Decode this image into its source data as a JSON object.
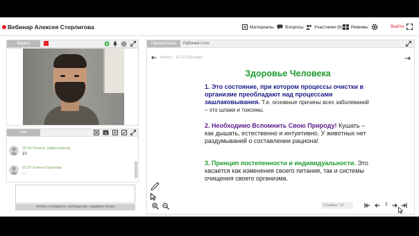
{
  "header": {
    "title": "Вебинар Алексея Стерлигова",
    "nav": {
      "materials": "Материалы",
      "questions": "Вопросы",
      "participants": "Участники (6)",
      "modes": "Режимы"
    },
    "exit": "Выйти"
  },
  "video": {
    "tab": "Видео"
  },
  "chat": {
    "tab": "Чат",
    "messages": [
      {
        "time": "20:04",
        "author": "Ренель Хайруллинов",
        "text": "10"
      },
      {
        "time": "20:07",
        "author": "Елена Горелова",
        "text": "..."
      }
    ],
    "send_label": "Чтобы отправить сообщение, нажмите Enter"
  },
  "presentation": {
    "tab": "Презентация",
    "desktop_tab": "Рабочий стол",
    "file_name": "Sekret... 15.12.2016.pptx",
    "slide": {
      "title": "Здоровье Человека",
      "items": [
        {
          "number": "1.",
          "bold": "Это состояние, при котором процессы очистки в организме преобладают над процессами зашлаковывания.",
          "rest": "Т.е. основные причины всех заболеваний – это шлаки и токсины."
        },
        {
          "number": "2.",
          "bold": "Необходимо Вспомнить Свою Природу!",
          "rest": "Кушать – как дышать, естественно и интуитивно. У животных нет раздумываний о составлении рациона!"
        },
        {
          "number": "3.",
          "bold": "Принцип постепенности и индивидуальности.",
          "rest": "Это касается как изменения своего питания, так и системы очищения своего организма."
        }
      ]
    },
    "pager": {
      "label": "Слайды",
      "total": "12",
      "current": "3"
    }
  },
  "colors": {
    "accent_red": "#e8202a",
    "slide_title": "#1d9b2d",
    "item1_bold": "#1c1c88",
    "item2_bold": "#5a1b8a",
    "item3_bold": "#1d9b2d",
    "chat_author": "#7aa65a"
  }
}
